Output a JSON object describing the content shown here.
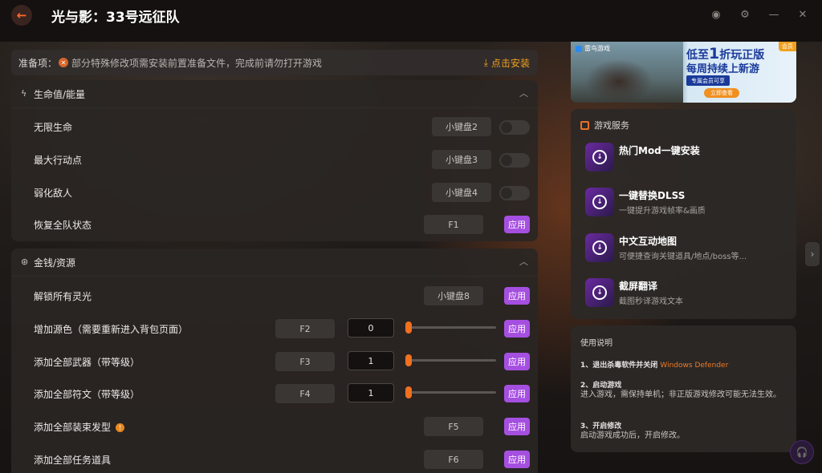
{
  "window": {
    "title": "光与影：33号远征队",
    "back_icon": "arrow-left-icon",
    "controls": [
      "theme-icon",
      "settings-icon",
      "minimize-icon",
      "collapse-icon"
    ]
  },
  "prep": {
    "label": "准备项：",
    "warning": "部分特殊修改项需安装前置准备文件，完成前请勿打开游戏",
    "install": "点击安装"
  },
  "sections": [
    {
      "title": "生命值/能量",
      "rows": [
        {
          "name": "无限生命",
          "key": "小键盘2",
          "control": "toggle"
        },
        {
          "name": "最大行动点",
          "key": "小键盘3",
          "control": "toggle"
        },
        {
          "name": "弱化敌人",
          "key": "小键盘4",
          "control": "toggle"
        },
        {
          "name": "恢复全队状态",
          "key": "F1",
          "control": "apply"
        }
      ]
    },
    {
      "title": "金钱/资源",
      "rows": [
        {
          "name": "解锁所有灵光",
          "key": "小键盘8",
          "control": "apply"
        },
        {
          "name": "增加源色（需要重新进入背包页面）",
          "key": "F2",
          "value": "0",
          "control": "slider"
        },
        {
          "name": "添加全部武器（带等级）",
          "key": "F3",
          "value": "1",
          "control": "slider"
        },
        {
          "name": "添加全部符文（带等级）",
          "key": "F4",
          "value": "1",
          "control": "slider"
        },
        {
          "name": "添加全部装束发型",
          "key": "F5",
          "control": "apply",
          "info": "!"
        },
        {
          "name": "添加全部任务道具",
          "key": "F6",
          "control": "apply"
        }
      ]
    }
  ],
  "apply_label": "应用",
  "banner": {
    "brand": "雷鸟游戏",
    "vip": "会员",
    "line1_pre": "低至",
    "line1_num": "1",
    "line1_post": "折玩正版",
    "line2": "每周持续上新游",
    "line3": "专属会员可享",
    "cta": "立即查看"
  },
  "services": {
    "title": "游戏服务",
    "items": [
      {
        "title": "热门Mod一键安装",
        "desc": ""
      },
      {
        "title": "一键替换DLSS",
        "desc": "一键提升游戏帧率&画质"
      },
      {
        "title": "中文互动地图",
        "desc": "可便捷查询关键道具/地点/boss等..."
      },
      {
        "title": "截屏翻译",
        "desc": "截图秒译游戏文本"
      }
    ]
  },
  "usage": {
    "title": "使用说明",
    "step1": "1、退出杀毒软件并关闭",
    "step1_hl": "Windows Defender",
    "step2": "2、启动游戏",
    "step2_desc": "进入游戏，需保持单机；非正版游戏修改可能无法生效。",
    "step3": "3、开启修改",
    "step3_desc": "启动游戏成功后，开启修改。"
  },
  "colors": {
    "accent": "#a54fe0",
    "orange": "#f07020",
    "install": "#f0a020"
  }
}
